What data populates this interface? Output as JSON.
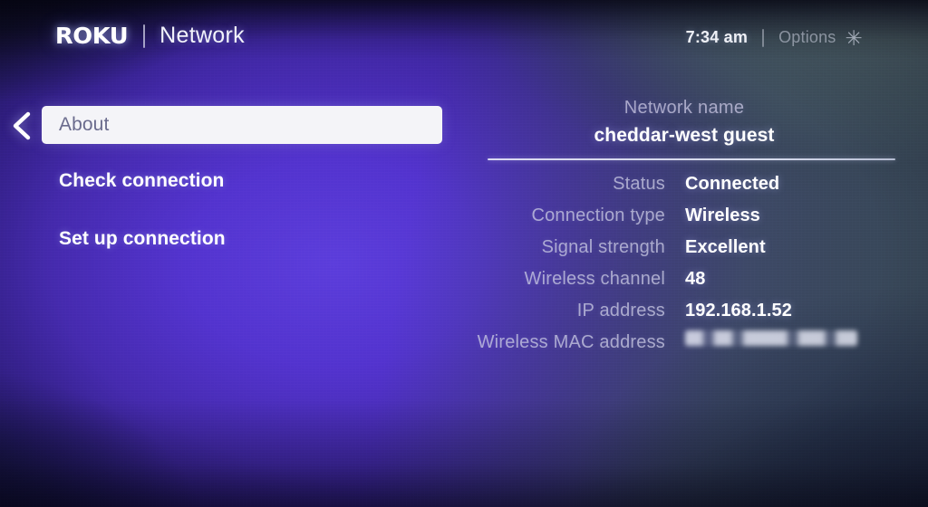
{
  "header": {
    "brand": "ROKU",
    "separator": "|",
    "title": "Network",
    "clock": "7:34 am",
    "status_separator": "|",
    "options_label": "Options",
    "options_icon": "asterisk-icon",
    "asterisk_glyph": "✳"
  },
  "nav": {
    "back_icon": "chevron-left-icon",
    "items": [
      {
        "label": "About",
        "selected": true
      },
      {
        "label": "Check connection",
        "selected": false
      },
      {
        "label": "Set up connection",
        "selected": false
      }
    ]
  },
  "info": {
    "network_name_label": "Network name",
    "network_name_value": "cheddar-west guest",
    "rows": [
      {
        "label": "Status",
        "value": "Connected",
        "redacted": false
      },
      {
        "label": "Connection type",
        "value": "Wireless",
        "redacted": false
      },
      {
        "label": "Signal strength",
        "value": "Excellent",
        "redacted": false
      },
      {
        "label": "Wireless channel",
        "value": "48",
        "redacted": false
      },
      {
        "label": "IP address",
        "value": "192.168.1.52",
        "redacted": false
      },
      {
        "label": "Wireless MAC address",
        "value": "",
        "redacted": true
      }
    ]
  },
  "colors": {
    "accent_purple": "#5233ce",
    "core_purple": "#4a2bbd",
    "dark_navy": "#191548",
    "slate_right": "#3e4c5c",
    "highlight_bg": "#f4f4f8",
    "highlight_text": "#6a6b8d",
    "text_primary": "#ffffff",
    "text_muted": "#cbcae4"
  }
}
